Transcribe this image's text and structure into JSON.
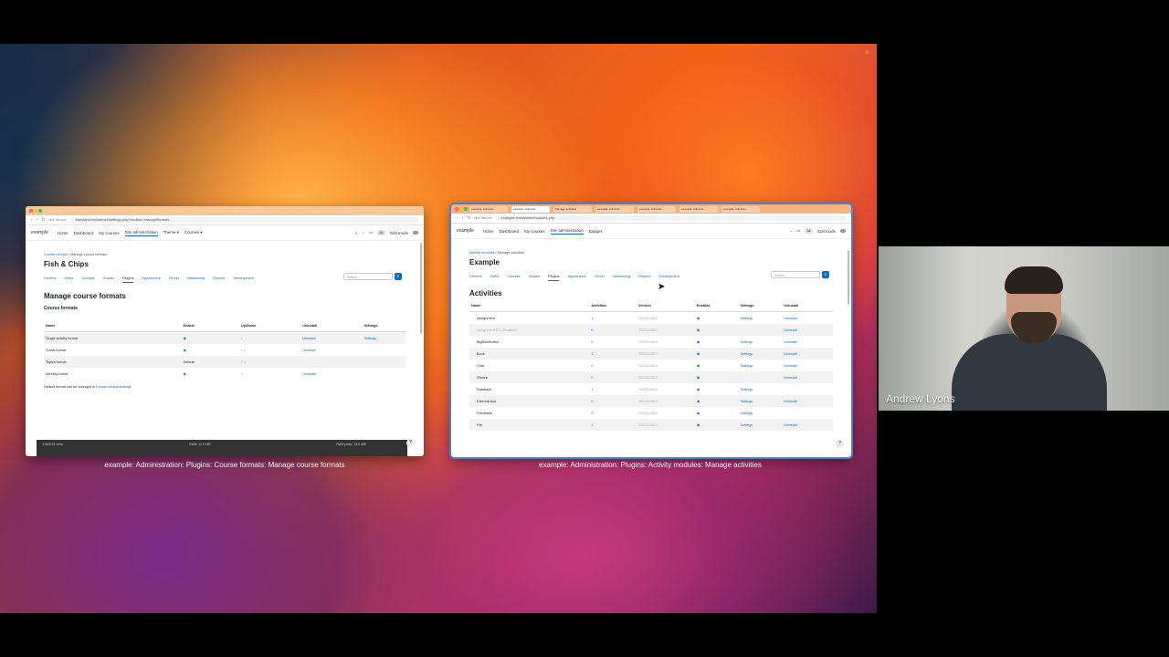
{
  "left_window": {
    "urlbar": {
      "security": "Not Secure",
      "url": "standard.test/admin/settings.php?section=manageformats"
    },
    "nav": {
      "brand": "example",
      "items": [
        "Home",
        "Dashboard",
        "My courses",
        "Site administration",
        "Theme",
        "Courses"
      ],
      "avatar": "AL",
      "edit_mode": "Edit mode"
    },
    "breadcrumb": {
      "first": "Course formats",
      "second": "Manage course formats"
    },
    "title": "Fish & Chips",
    "search_placeholder": "Search",
    "subnav": [
      "General",
      "Users",
      "Courses",
      "Grades",
      "Plugins",
      "Appearance",
      "Server",
      "Networking",
      "Reports",
      "Development"
    ],
    "heading": "Manage course formats",
    "subheading": "Course formats",
    "table": {
      "headers": [
        "Name",
        "Enable",
        "Up/Down",
        "Uninstall",
        "Settings"
      ],
      "rows": [
        {
          "name": "Single activity format",
          "enable": "◉",
          "updown": "↓",
          "uninstall": "Uninstall",
          "settings": "Settings"
        },
        {
          "name": "Social format",
          "enable": "◉",
          "updown": "↑ ↓",
          "uninstall": "Uninstall",
          "settings": ""
        },
        {
          "name": "Topics format",
          "enable": "Default",
          "updown": "↑ ↓",
          "uninstall": "",
          "settings": ""
        },
        {
          "name": "Weekly format",
          "enable": "◉",
          "updown": "↑",
          "uninstall": "Uninstall",
          "settings": ""
        }
      ]
    },
    "note_prefix": "Default format can be changed in",
    "note_link": "Course default settings",
    "footer": {
      "a": "3.0s/0.01 secs",
      "b": "RAM: 12.9 MB",
      "c": "RAM peak: 15.0 MB"
    }
  },
  "right_window": {
    "tabs": [
      "example: Administ...",
      "example: Administ...",
      "Manage activities",
      "example: Administ...",
      "example: Administ...",
      "example: Administ...",
      "example: Administ..."
    ],
    "urlbar": {
      "security": "Not Secure",
      "url": "example.test/admin/modules.php"
    },
    "nav": {
      "brand": "example",
      "items": [
        "Home",
        "Dashboard",
        "My courses",
        "Site administration",
        "Badges"
      ],
      "avatar": "AL",
      "edit_mode": "Edit mode"
    },
    "breadcrumb": {
      "first": "Activity modules",
      "second": "Manage activities"
    },
    "title": "Example",
    "search_placeholder": "Search",
    "subnav": [
      "General",
      "Users",
      "Courses",
      "Grades",
      "Plugins",
      "Appearance",
      "Server",
      "Networking",
      "Reports",
      "Development"
    ],
    "heading": "Activities",
    "table": {
      "headers": [
        "Name",
        "Activities",
        "Version",
        "Enabled",
        "Settings",
        "Uninstall"
      ],
      "rows": [
        {
          "name": "Assignment",
          "count": "1",
          "version": "2022112800",
          "enabled": "◉",
          "settings": "Settings",
          "uninstall": "Uninstall",
          "muted": false
        },
        {
          "name": "Assignment 2.2 (Disabled)",
          "count": "0",
          "version": "2022112800",
          "enabled": "◉",
          "settings": "",
          "uninstall": "Uninstall",
          "muted": true
        },
        {
          "name": "BigBlueButton",
          "count": "0",
          "version": "2022112800",
          "enabled": "◉",
          "settings": "Settings",
          "uninstall": "Uninstall",
          "muted": false
        },
        {
          "name": "Book",
          "count": "1",
          "version": "2022112800",
          "enabled": "◉",
          "settings": "Settings",
          "uninstall": "Uninstall",
          "muted": false
        },
        {
          "name": "Chat",
          "count": "0",
          "version": "2022112800",
          "enabled": "◉",
          "settings": "Settings",
          "uninstall": "Uninstall",
          "muted": false
        },
        {
          "name": "Choice",
          "count": "0",
          "version": "2022112800",
          "enabled": "◉",
          "settings": "",
          "uninstall": "Uninstall",
          "muted": false
        },
        {
          "name": "Database",
          "count": "1",
          "version": "2022112800",
          "enabled": "◉",
          "settings": "Settings",
          "uninstall": "",
          "muted": false
        },
        {
          "name": "External tool",
          "count": "0",
          "version": "2022112800",
          "enabled": "◉",
          "settings": "Settings",
          "uninstall": "Uninstall",
          "muted": false
        },
        {
          "name": "Feedback",
          "count": "0",
          "version": "2022112800",
          "enabled": "◉",
          "settings": "Settings",
          "uninstall": "",
          "muted": false
        },
        {
          "name": "File",
          "count": "1",
          "version": "2022112800",
          "enabled": "◉",
          "settings": "Settings",
          "uninstall": "Uninstall",
          "muted": false
        }
      ]
    }
  },
  "captions": {
    "left": "example: Administration: Plugins: Course formats: Manage course formats",
    "right": "example: Administration: Plugins: Activity modules: Manage activities"
  },
  "video": {
    "name": "Andrew Lyons"
  }
}
